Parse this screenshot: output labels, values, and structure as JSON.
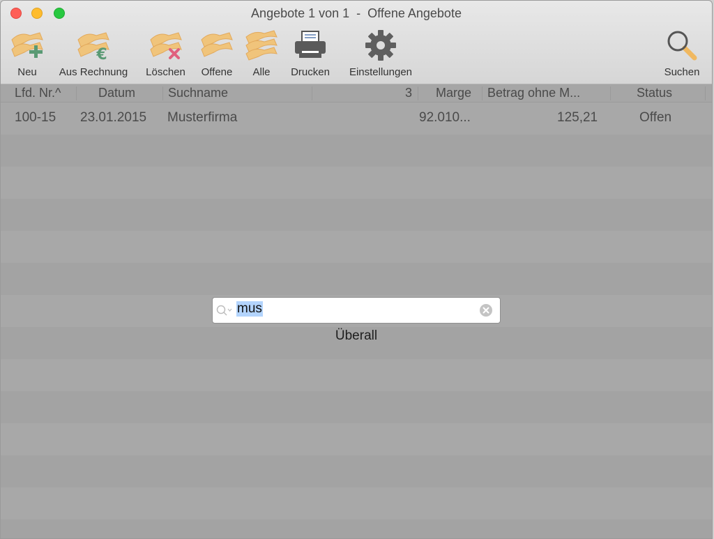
{
  "window": {
    "title": "Angebote 1 von 1  -  Offene Angebote"
  },
  "toolbar": {
    "items": [
      {
        "label": "Neu",
        "icon": "bricks-plus-icon"
      },
      {
        "label": "Aus Rechnung",
        "icon": "bricks-euro-icon"
      },
      {
        "label": "Löschen",
        "icon": "bricks-delete-icon"
      },
      {
        "label": "Offene",
        "icon": "bricks-icon"
      },
      {
        "label": "Alle",
        "icon": "bricks-stack-icon"
      },
      {
        "label": "Drucken",
        "icon": "printer-icon"
      },
      {
        "label": "Einstellungen",
        "icon": "gear-icon"
      },
      {
        "label": "Suchen",
        "icon": "magnifier-icon"
      }
    ]
  },
  "table": {
    "columns": [
      "Lfd. Nr.^",
      "Datum",
      "Suchname",
      "3",
      "Marge",
      "Betrag ohne M...",
      "Status"
    ],
    "rows": [
      {
        "lfd": "100-15",
        "datum": "23.01.2015",
        "suchname": "Musterfirma",
        "marge": "92.010...",
        "betrag": "125,21",
        "status": "Offen"
      }
    ]
  },
  "search": {
    "value": "mus",
    "scope": "Überall"
  },
  "colors": {
    "brick": "#f0c47b",
    "accent_green": "#5a9a74",
    "delete_red": "#e0607e",
    "selection": "#b3d4fd"
  }
}
